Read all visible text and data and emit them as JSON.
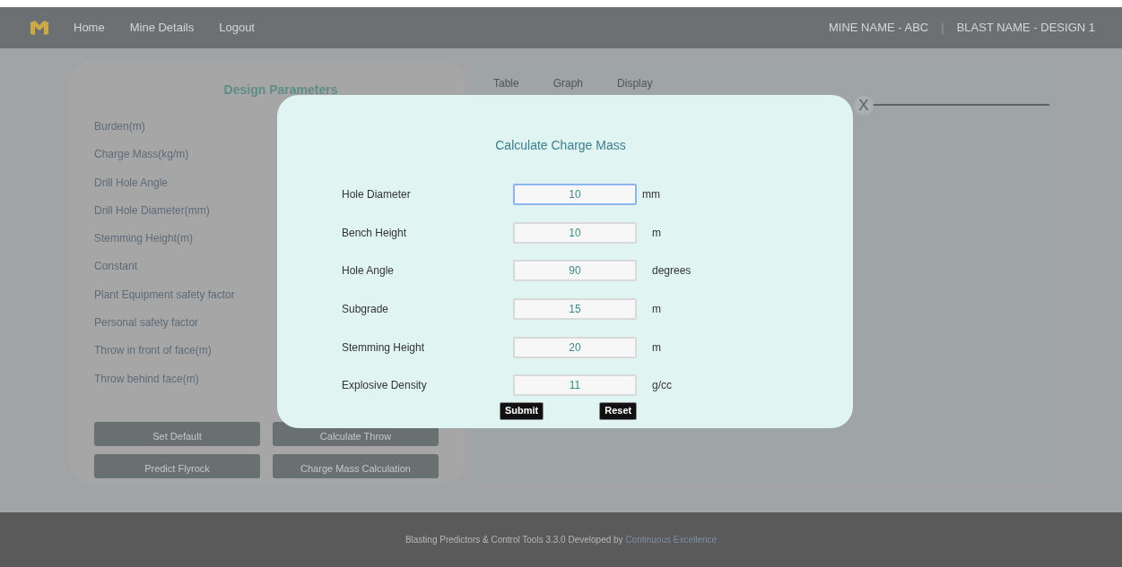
{
  "header": {
    "nav": [
      "Home",
      "Mine Details",
      "Logout"
    ],
    "mine_name": "MINE NAME -  ABC",
    "separator": "|",
    "blast_name": "BLAST NAME -  DESIGN 1"
  },
  "design_parameters": {
    "title": "Design Parameters",
    "labels": [
      "Burden(m)",
      "Charge Mass(kg/m)",
      "Drill Hole Angle",
      "Drill Hole Diameter(mm)",
      "Stemming Height(m)",
      "Constant",
      "Plant Equipment safety factor",
      "Personal safety factor",
      "Throw in front of face(m)",
      "Throw behind face(m)"
    ],
    "buttons": [
      "Set Default",
      "Calculate Throw",
      "Predict Flyrock",
      "Charge Mass Calculation"
    ]
  },
  "results_tabs": [
    {
      "label": "Table",
      "selected": false
    },
    {
      "label": "Graph",
      "selected": false
    },
    {
      "label": "Display",
      "selected": false
    }
  ],
  "dialog": {
    "close": "X",
    "title": "Calculate Charge Mass",
    "fields": [
      {
        "label": "Hole Diameter",
        "value": "10",
        "unit": "mm",
        "focused": true
      },
      {
        "label": "Bench Height",
        "value": "10",
        "unit": "m",
        "focused": false
      },
      {
        "label": "Hole Angle",
        "value": "90",
        "unit": "degrees",
        "focused": false
      },
      {
        "label": "Subgrade",
        "value": "15",
        "unit": "m",
        "focused": false
      },
      {
        "label": "Stemming Height",
        "value": "20",
        "unit": "m",
        "focused": false
      },
      {
        "label": "Explosive Density",
        "value": "11",
        "unit": "g/cc",
        "focused": false
      }
    ],
    "buttons": [
      "Submit",
      "Reset"
    ]
  },
  "footer": {
    "text": "Blasting Predictors & Control Tools 3.3.0 Developed by ",
    "link": "Continuous Excellence"
  }
}
